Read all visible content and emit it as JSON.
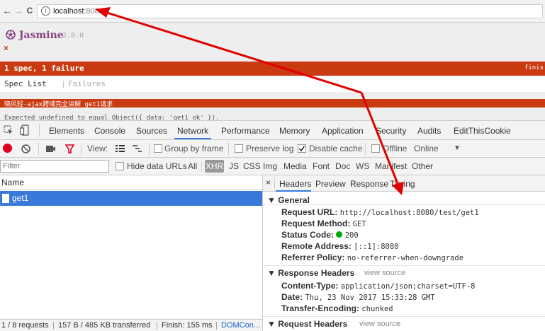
{
  "browser": {
    "back_icon": "←",
    "forward_icon": "→",
    "reload_icon": "C",
    "url_host": "localhost",
    "url_port": ":8081"
  },
  "jasmine": {
    "logo": "Jasmine",
    "version": "2.8.0",
    "fail_mark": "×",
    "summary": "1 spec, 1 failure",
    "summary_right": "finis",
    "spec_list_label": "Spec List",
    "tab_separator": "|",
    "failures_label": "Failures",
    "failing_spec": "晓风轻-ajax跨域完全讲解 get1请求",
    "expectation": "Expected undefined to equal Object({ data: 'get1 ok' })."
  },
  "devtools": {
    "tabs": [
      "Elements",
      "Console",
      "Sources",
      "Network",
      "Performance",
      "Memory",
      "Application",
      "Security",
      "Audits",
      "EditThisCookie"
    ],
    "active_tab": "Network",
    "toolbar": {
      "view_label": "View:",
      "group_by_frame": "Group by frame",
      "preserve_log": "Preserve log",
      "disable_cache": "Disable cache",
      "offline": "Offline",
      "online": "Online",
      "disable_cache_checked": true
    },
    "filter": {
      "placeholder": "Filter",
      "hide_data_urls": "Hide data URLs",
      "types": [
        "All",
        "XHR",
        "JS",
        "CSS",
        "Img",
        "Media",
        "Font",
        "Doc",
        "WS",
        "Manifest",
        "Other"
      ],
      "active_type": "XHR"
    },
    "request_list": {
      "header": "Name",
      "rows": [
        "get1"
      ],
      "selected": "get1"
    },
    "status": {
      "requests": "1 / 8 requests",
      "transferred": "157 B / 485 KB transferred",
      "finish": "Finish: 155 ms",
      "domcontent": "DOMCon..."
    },
    "detail": {
      "close": "×",
      "tabs": [
        "Headers",
        "Preview",
        "Response",
        "Timing"
      ],
      "active_tab": "Headers",
      "general": {
        "title": "General",
        "request_url_k": "Request URL:",
        "request_url_v": "http://localhost:8080/test/get1",
        "method_k": "Request Method:",
        "method_v": "GET",
        "status_k": "Status Code:",
        "status_v": "200",
        "remote_k": "Remote Address:",
        "remote_v": "[::1]:8080",
        "referrer_k": "Referrer Policy:",
        "referrer_v": "no-referrer-when-downgrade"
      },
      "response_headers": {
        "title": "Response Headers",
        "view_source": "view source",
        "content_type_k": "Content-Type:",
        "content_type_v": "application/json;charset=UTF-8",
        "date_k": "Date:",
        "date_v": "Thu, 23 Nov 2017 15:33:28 GMT",
        "transfer_k": "Transfer-Encoding:",
        "transfer_v": "chunked"
      },
      "request_headers": {
        "title": "Request Headers",
        "view_source": "view source"
      }
    }
  },
  "colors": {
    "jasmine_fail": "#ca3a11",
    "selection": "#3879d9",
    "annotation_arrow": "#e00000"
  }
}
